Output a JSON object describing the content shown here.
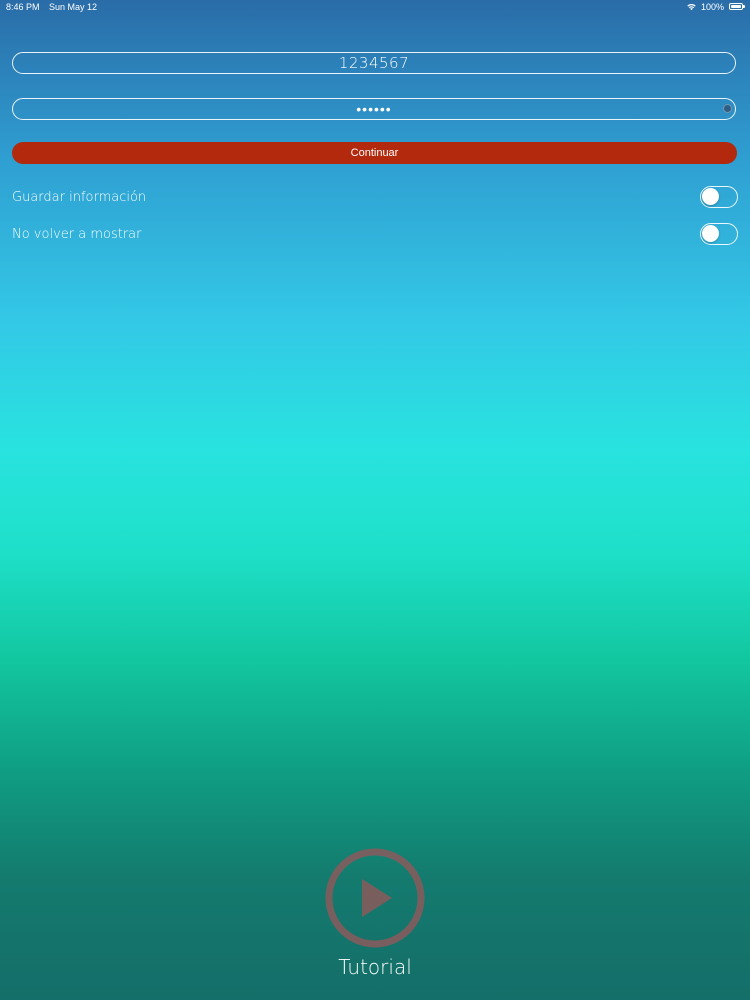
{
  "status_bar": {
    "time": "8:46 PM",
    "date": "Sun May 12",
    "battery_percent": "100%",
    "wifi_icon": "wifi-icon",
    "battery_icon": "battery-icon"
  },
  "login": {
    "user_value": "1234567",
    "password_value": "••••••",
    "continue_label": "Continuar",
    "continue_color": "#b3290d"
  },
  "options": {
    "save_info_label": "Guardar información",
    "save_info_on": false,
    "no_show_label": "No volver a mostrar",
    "no_show_on": false
  },
  "tutorial": {
    "label": "Tutorial",
    "icon": "play-icon",
    "icon_color": "#8a5a5c"
  }
}
